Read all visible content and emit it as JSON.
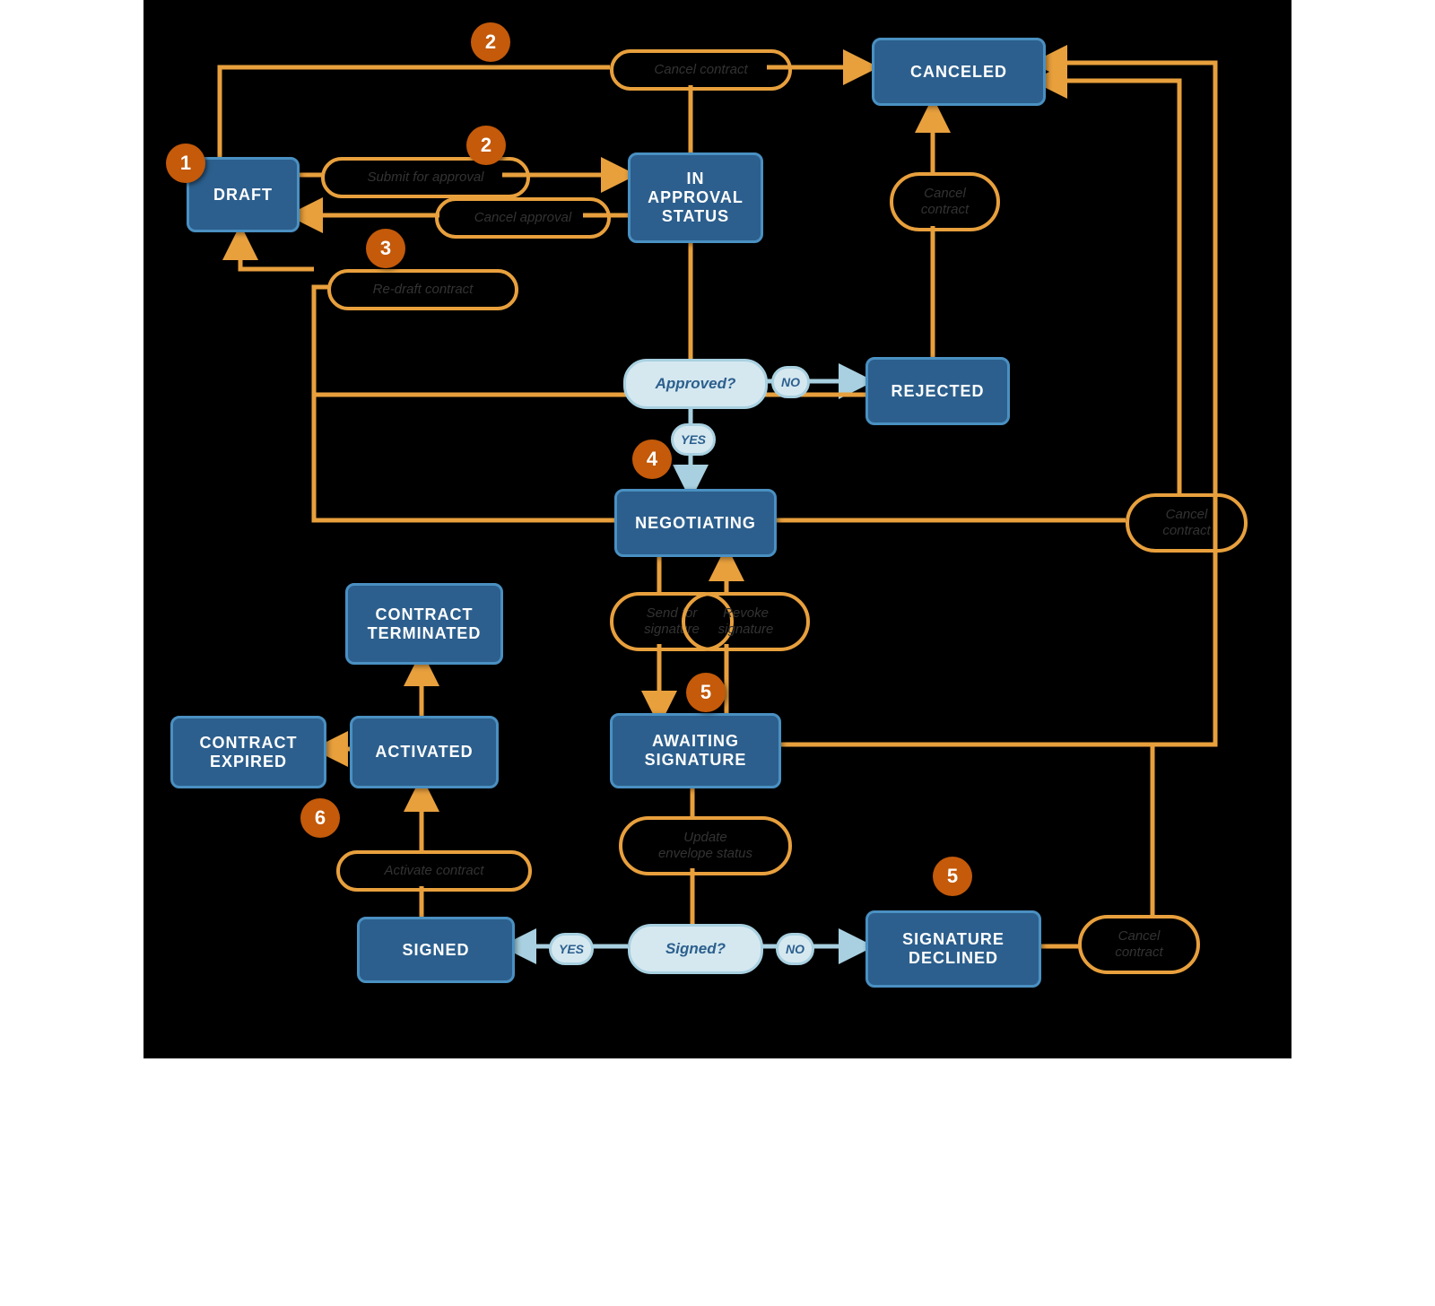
{
  "states": {
    "draft": "DRAFT",
    "in_approval": "IN\nAPPROVAL\nSTATUS",
    "canceled": "CANCELED",
    "rejected": "REJECTED",
    "negotiating": "NEGOTIATING",
    "contract_terminated": "CONTRACT\nTERMINATED",
    "activated": "ACTIVATED",
    "contract_expired": "CONTRACT\nEXPIRED",
    "awaiting_signature": "AWAITING\nSIGNATURE",
    "signed": "SIGNED",
    "signature_declined": "SIGNATURE\nDECLINED"
  },
  "actions": {
    "cancel_contract": "Cancel contract",
    "submit_for_approval": "Submit for approval",
    "cancel_approval": "Cancel approval",
    "re_draft_contract": "Re-draft contract",
    "cancel_contract_2": "Cancel\ncontract",
    "cancel_contract_3": "Cancel\ncontract",
    "cancel_contract_4": "Cancel\ncontract",
    "send_for_signature": "Send for\nsignature",
    "revoke_signature": "Revoke\nsignature",
    "update_envelope_status": "Update\nenvelope status",
    "activate_contract": "Activate contract"
  },
  "decisions": {
    "approved": "Approved?",
    "signed": "Signed?"
  },
  "dec_labels": {
    "no": "NO",
    "yes": "YES"
  },
  "markers": {
    "m1": "1",
    "m2a": "2",
    "m2b": "2",
    "m3": "3",
    "m4": "4",
    "m5a": "5",
    "m5b": "5",
    "m6": "6"
  }
}
